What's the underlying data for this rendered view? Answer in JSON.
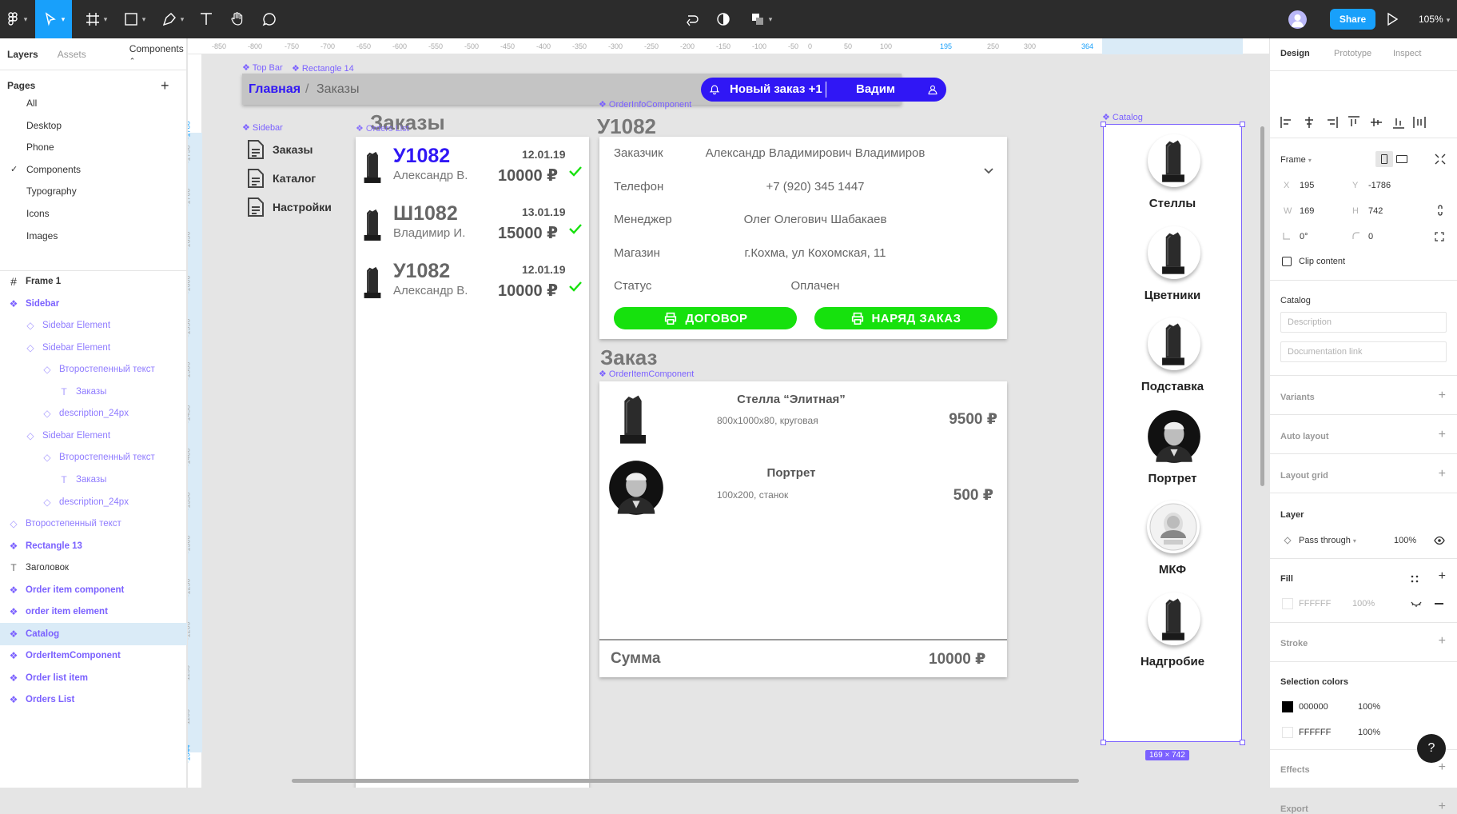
{
  "toolbar": {
    "share_label": "Share",
    "zoom": "105%"
  },
  "left_panel": {
    "tabs": [
      "Layers",
      "Assets",
      "Components"
    ],
    "pages_title": "Pages",
    "pages": [
      "All",
      "Desktop",
      "Phone",
      "Components",
      "Typography",
      "Icons",
      "Images"
    ],
    "layers": [
      {
        "label": "Frame 1",
        "type": "frame",
        "depth": 0
      },
      {
        "label": "Sidebar",
        "type": "component",
        "depth": 0
      },
      {
        "label": "Sidebar Element",
        "type": "instance",
        "depth": 1
      },
      {
        "label": "Sidebar Element",
        "type": "instance",
        "depth": 1
      },
      {
        "label": "Второстепенный текст",
        "type": "instance",
        "depth": 2
      },
      {
        "label": "Заказы",
        "type": "text",
        "depth": 3
      },
      {
        "label": "description_24px",
        "type": "instance",
        "depth": 2
      },
      {
        "label": "Sidebar Element",
        "type": "instance",
        "depth": 1
      },
      {
        "label": "Второстепенный текст",
        "type": "instance",
        "depth": 2
      },
      {
        "label": "Заказы",
        "type": "text",
        "depth": 3
      },
      {
        "label": "description_24px",
        "type": "instance",
        "depth": 2
      },
      {
        "label": "Второстепенный текст",
        "type": "instance",
        "depth": 0
      },
      {
        "label": "Rectangle 13",
        "type": "component",
        "depth": 0
      },
      {
        "label": "Заголовок",
        "type": "text",
        "depth": 0
      },
      {
        "label": "Order item component",
        "type": "component",
        "depth": 0
      },
      {
        "label": "order item element",
        "type": "component",
        "depth": 0
      },
      {
        "label": "Catalog",
        "type": "component",
        "depth": 0,
        "selected": true
      },
      {
        "label": "OrderItemComponent",
        "type": "component",
        "depth": 0
      },
      {
        "label": "Order list item",
        "type": "component",
        "depth": 0
      },
      {
        "label": "Orders List",
        "type": "component",
        "depth": 0
      }
    ]
  },
  "canvas": {
    "ruler_top": [
      "-850",
      "-800",
      "-750",
      "-700",
      "-650",
      "-600",
      "-550",
      "-500",
      "-450",
      "-400",
      "-350",
      "-300",
      "-250",
      "-200",
      "-150",
      "-100",
      "-50",
      "0",
      "50",
      "100",
      "195",
      "250",
      "300",
      "364"
    ],
    "ruler_left": [
      "-1786",
      "-1750",
      "-1700",
      "-1650",
      "-1600",
      "-1550",
      "-1500",
      "-1450",
      "-1400",
      "-1350",
      "-1300",
      "-1250",
      "-1200",
      "-1150",
      "-1100",
      "-1044"
    ],
    "labels": {
      "top_bar": "Top Bar",
      "rect14": "Rectangle 14",
      "order_info": "OrderInfoComponent",
      "sidebar": "Sidebar",
      "orders_list": "Orders List",
      "catalog": "Catalog",
      "order_item": "OrderItemComponent",
      "size_badge": "169 × 742"
    },
    "topbar": {
      "crumb_home": "Главная",
      "crumb_sep": "/",
      "crumb_current": "Заказы",
      "new_order": "Новый заказ +1",
      "user": "Вадим"
    },
    "sidebar_items": [
      "Заказы",
      "Каталог",
      "Настройки"
    ],
    "orders_title": "Заказы",
    "orders": [
      {
        "id": "У1082",
        "name": "Александр В.",
        "date": "12.01.19",
        "sum": "10000 ₽",
        "active": true
      },
      {
        "id": "Ш1082",
        "name": "Владимир И.",
        "date": "13.01.19",
        "sum": "15000 ₽",
        "active": false
      },
      {
        "id": "У1082",
        "name": "Александр В.",
        "date": "12.01.19",
        "sum": "10000 ₽",
        "active": false
      }
    ],
    "order_info": {
      "title": "У1082",
      "rows": [
        {
          "label": "Заказчик",
          "value": "Александр Владимирович Владимиров"
        },
        {
          "label": "Телефон",
          "value": "+7 (920) 345 1447"
        },
        {
          "label": "Менеджер",
          "value": "Олег Олегович Шабакаев"
        },
        {
          "label": "Магазин",
          "value": "г.Кохма, ул Кохомская, 11"
        },
        {
          "label": "Статус",
          "value": "Оплачен"
        }
      ],
      "btn_contract": "ДОГОВОР",
      "btn_order": "НАРЯД ЗАКАЗ"
    },
    "order_items": {
      "title": "Заказ",
      "items": [
        {
          "name": "Стелла “Элитная”",
          "desc": "800x1000x80, круговая",
          "price": "9500 ₽"
        },
        {
          "name": "Портрет",
          "desc": "100x200, станок",
          "price": "500 ₽"
        }
      ],
      "total_label": "Сумма",
      "total_value": "10000 ₽"
    },
    "catalog": [
      "Стеллы",
      "Цветники",
      "Подставка",
      "Портрет",
      "МКФ",
      "Надгробие"
    ]
  },
  "right_panel": {
    "tabs": [
      "Design",
      "Prototype",
      "Inspect"
    ],
    "frame_label": "Frame",
    "x_label": "X",
    "x": "195",
    "y_label": "Y",
    "y": "-1786",
    "w_label": "W",
    "w": "169",
    "h_label": "H",
    "h": "742",
    "rotation": "0°",
    "radius": "0",
    "clip_content": "Clip content",
    "component_title": "Catalog",
    "description_placeholder": "Description",
    "doc_link_placeholder": "Documentation link",
    "variants": "Variants",
    "auto_layout": "Auto layout",
    "layout_grid": "Layout grid",
    "layer_title": "Layer",
    "blend_mode": "Pass through",
    "layer_opacity": "100%",
    "fill_title": "Fill",
    "fill_hex": "FFFFFF",
    "fill_opacity": "100%",
    "stroke_title": "Stroke",
    "selection_colors_title": "Selection colors",
    "selection_colors": [
      {
        "hex": "000000",
        "opacity": "100%",
        "color": "#000000"
      },
      {
        "hex": "FFFFFF",
        "opacity": "100%",
        "color": "#FFFFFF"
      }
    ],
    "effects": "Effects",
    "export": "Export",
    "help": "?"
  },
  "colors": {
    "figma_blue": "#18a0fb",
    "component_purple": "#7b61ff",
    "brand_blue": "#3017f5",
    "green": "#16e10d"
  }
}
